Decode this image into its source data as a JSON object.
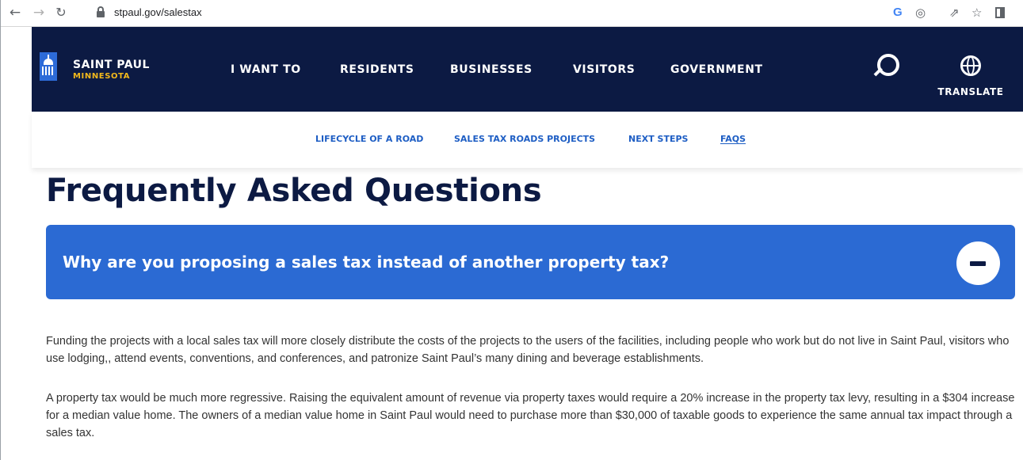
{
  "browser": {
    "url": "stpaul.gov/salestax",
    "icons": [
      "back-icon",
      "forward-icon",
      "reload-icon",
      "lock-icon",
      "google-icon",
      "eye-off-icon",
      "share-icon",
      "star-icon",
      "side-panel-icon"
    ]
  },
  "site": {
    "brand_name": "SAINT PAUL",
    "brand_sub": "MINNESOTA",
    "nav": [
      "I WANT TO",
      "RESIDENTS",
      "BUSINESSES",
      "VISITORS",
      "GOVERNMENT"
    ],
    "translate_label": "TRANSLATE"
  },
  "subnav": {
    "items": [
      "LIFECYCLE OF A ROAD",
      "SALES TAX ROADS PROJECTS",
      "NEXT STEPS",
      "FAQS"
    ],
    "active": "FAQS"
  },
  "page": {
    "title": "Frequently Asked Questions",
    "faq": {
      "question": "Why are you proposing a sales tax instead of another property tax?",
      "answer_1": "Funding the projects with a local sales tax will more closely distribute the costs of the projects to the users of the facilities, including people who work but do not live in Saint Paul, visitors who use lodging,, attend events, conventions, and conferences, and patronize Saint Paul’s many dining and beverage establishments.",
      "answer_2": "A property tax would be much more regressive. Raising the equivalent amount of revenue via property taxes would require a 20% increase in the property tax levy, resulting in a $304 increase for a median value home. The owners of a median value home in Saint Paul would need to purchase more than $30,000 of taxable goods to experience the same annual tax impact through a sales tax."
    }
  },
  "colors": {
    "header_bg": "#0c1a43",
    "accent_blue": "#2b6ad3",
    "brand_gold": "#f2b81c",
    "link_blue": "#1e5ec4"
  }
}
